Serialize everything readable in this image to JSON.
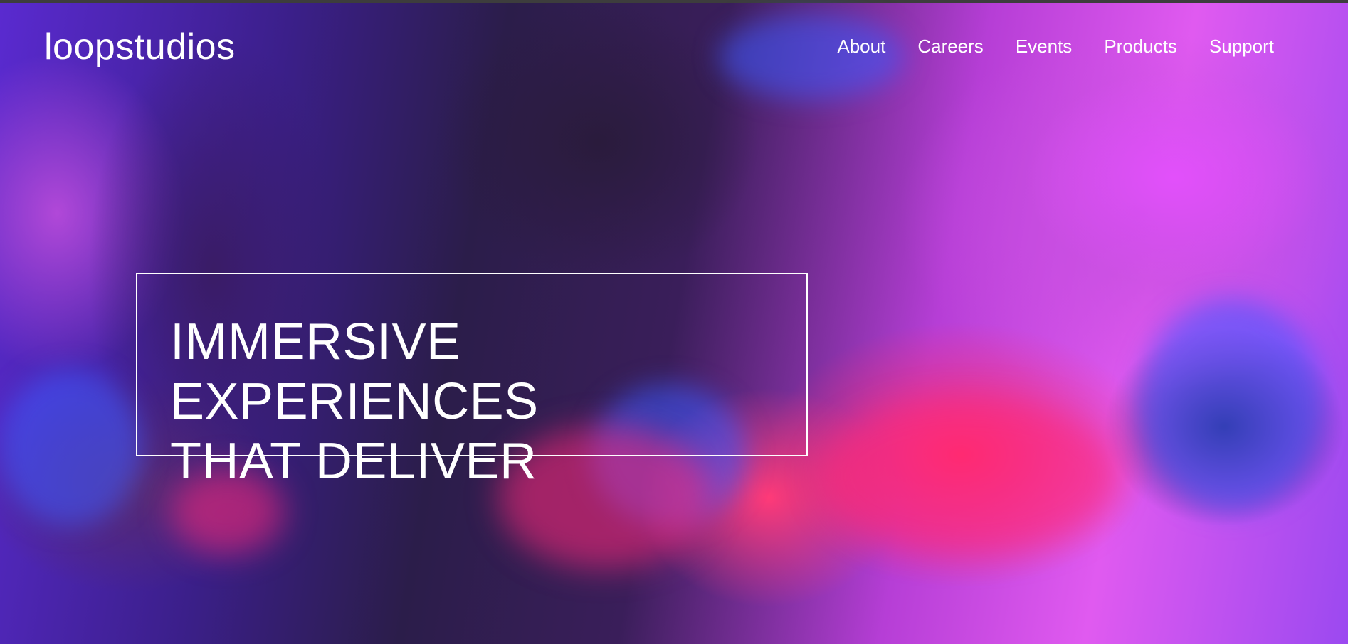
{
  "header": {
    "logo_text": "loopstudios",
    "nav": [
      {
        "label": "About"
      },
      {
        "label": "Careers"
      },
      {
        "label": "Events"
      },
      {
        "label": "Products"
      },
      {
        "label": "Support"
      }
    ]
  },
  "hero": {
    "headline_line1": "IMMERSIVE EXPERIENCES",
    "headline_line2": "THAT DELIVER",
    "background_image": "person-wearing-vr-headset-with-steering-wheel"
  },
  "colors": {
    "text": "#ffffff",
    "accent_magenta": "#e05af0",
    "accent_pink": "#ff2d6a",
    "accent_blue": "#3c5aff",
    "dark": "#2b1d4a"
  }
}
